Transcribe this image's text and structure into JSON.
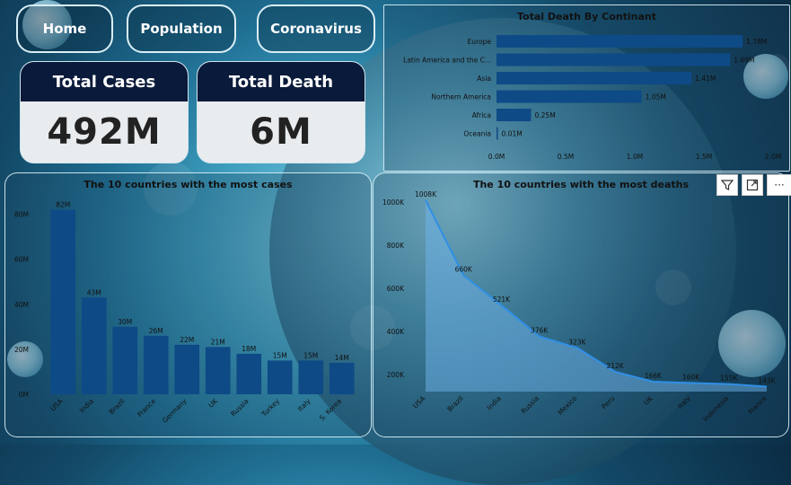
{
  "nav": {
    "home_label": "Home",
    "population_label": "Population",
    "coronavirus_label": "Coronavirus"
  },
  "kpis": {
    "total_cases": {
      "label": "Total Cases",
      "value": "492M"
    },
    "total_death": {
      "label": "Total Death",
      "value": "6M"
    }
  },
  "visual_toolbar": {
    "filter_icon": "filter-icon",
    "focus_icon": "focus-mode-icon",
    "more_icon": "more-options-icon",
    "more_glyph": "···"
  },
  "colors": {
    "bar": "#0e4a86",
    "line": "#2f8fe6",
    "area": "#6fb4ec",
    "kpi_header": "#0a1a3a"
  },
  "chart_data": [
    {
      "id": "continent",
      "type": "bar",
      "orientation": "horizontal",
      "title": "Total Death By Continant",
      "categories": [
        "Europe",
        "Latin America and the C...",
        "Asia",
        "Northern America",
        "Africa",
        "Oceania"
      ],
      "values": [
        1.78,
        1.69,
        1.41,
        1.05,
        0.25,
        0.01
      ],
      "value_labels": [
        "1.78M",
        "1.69M",
        "1.41M",
        "1.05M",
        "0.25M",
        "0.01M"
      ],
      "x_ticks": [
        "0.0M",
        "0.5M",
        "1.0M",
        "1.5M",
        "2.0M"
      ],
      "xlim": [
        0,
        2.0
      ],
      "unit": "M"
    },
    {
      "id": "cases",
      "type": "bar",
      "title": "The 10 countries with the most cases",
      "categories": [
        "USA",
        "India",
        "Brazil",
        "France",
        "Germany",
        "UK",
        "Russia",
        "Turkey",
        "Italy",
        "S. Korea"
      ],
      "values": [
        82,
        43,
        30,
        26,
        22,
        21,
        18,
        15,
        15,
        14
      ],
      "value_labels": [
        "82M",
        "43M",
        "30M",
        "26M",
        "22M",
        "21M",
        "18M",
        "15M",
        "15M",
        "14M"
      ],
      "y_ticks": [
        "0M",
        "20M",
        "40M",
        "60M",
        "80M"
      ],
      "ylim": [
        0,
        87
      ],
      "unit": "M"
    },
    {
      "id": "deaths",
      "type": "area",
      "title": "The 10 countries with the most deaths",
      "categories": [
        "USA",
        "Brazil",
        "India",
        "Russia",
        "Mexico",
        "Peru",
        "UK",
        "Italy",
        "Indonesia",
        "France"
      ],
      "values": [
        1008,
        660,
        521,
        376,
        323,
        212,
        166,
        160,
        155,
        143
      ],
      "value_labels": [
        "1008K",
        "660K",
        "521K",
        "376K",
        "323K",
        "212K",
        "166K",
        "160K",
        "155K",
        "143K"
      ],
      "y_ticks": [
        "200K",
        "400K",
        "600K",
        "800K",
        "1000K"
      ],
      "ylim": [
        120,
        1050
      ],
      "unit": "K"
    }
  ]
}
